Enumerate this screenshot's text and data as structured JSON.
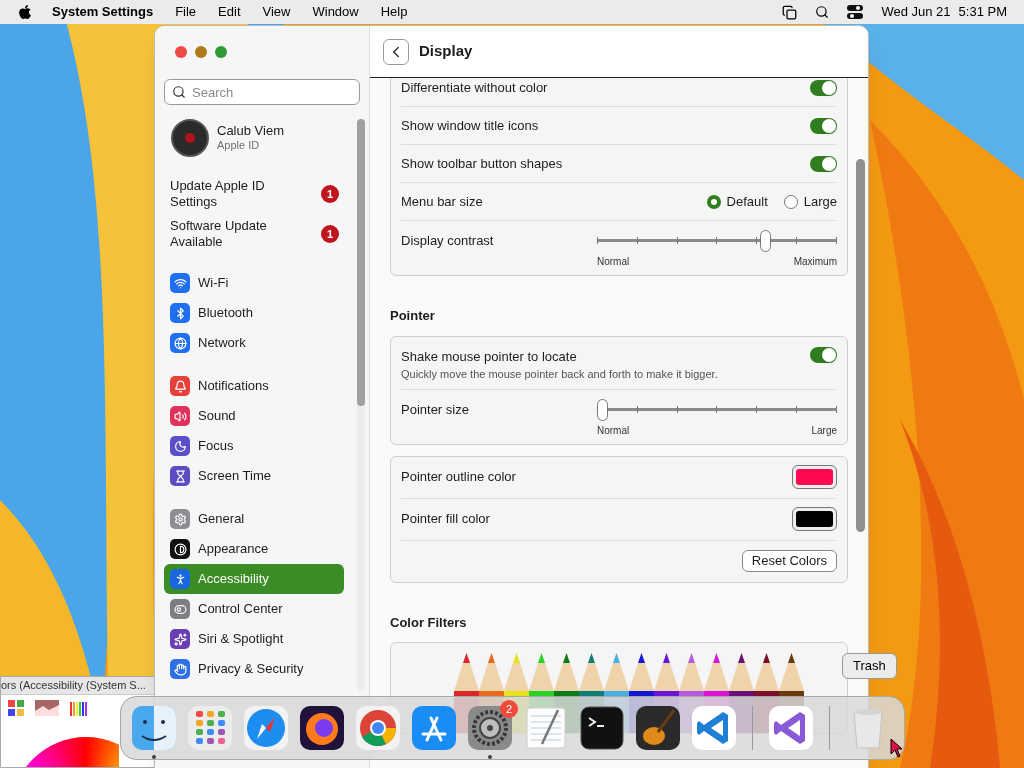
{
  "menu_bar": {
    "app_name": "System Settings",
    "menus": [
      "File",
      "Edit",
      "View",
      "Window",
      "Help"
    ],
    "date": "Wed Jun 21",
    "time": "5:31 PM"
  },
  "sidebar": {
    "search_placeholder": "Search",
    "account": {
      "name": "Calub Viem",
      "subtitle": "Apple ID"
    },
    "notices": [
      {
        "label": "Update Apple ID Settings",
        "badge": "1"
      },
      {
        "label": "Software Update Available",
        "badge": "1"
      }
    ],
    "groups": [
      {
        "items": [
          {
            "kind": "wifi",
            "label": "Wi-Fi",
            "selected": false
          },
          {
            "kind": "bluetooth",
            "label": "Bluetooth",
            "selected": false
          },
          {
            "kind": "network",
            "label": "Network",
            "selected": false
          }
        ]
      },
      {
        "items": [
          {
            "kind": "notifications",
            "label": "Notifications",
            "selected": false
          },
          {
            "kind": "sound",
            "label": "Sound",
            "selected": false
          },
          {
            "kind": "focus",
            "label": "Focus",
            "selected": false
          },
          {
            "kind": "screentime",
            "label": "Screen Time",
            "selected": false
          }
        ]
      },
      {
        "items": [
          {
            "kind": "general",
            "label": "General",
            "selected": false
          },
          {
            "kind": "appearance",
            "label": "Appearance",
            "selected": false
          },
          {
            "kind": "accessibility",
            "label": "Accessibility",
            "selected": true
          },
          {
            "kind": "controlcenter",
            "label": "Control Center",
            "selected": false
          },
          {
            "kind": "siri",
            "label": "Siri & Spotlight",
            "selected": false
          },
          {
            "kind": "privacy",
            "label": "Privacy & Security",
            "selected": false
          }
        ]
      }
    ]
  },
  "display": {
    "title": "Display",
    "sections": [
      {
        "groups": [
          {
            "rows": [
              {
                "kind": "toggle",
                "label": "Differentiate without color",
                "on": true
              },
              {
                "kind": "toggle",
                "label": "Show window title icons",
                "on": true
              },
              {
                "kind": "toggle",
                "label": "Show toolbar button shapes",
                "on": true
              },
              {
                "kind": "radio",
                "label": "Menu bar size",
                "options": [
                  {
                    "label": "Default",
                    "selected": true
                  },
                  {
                    "label": "Large",
                    "selected": false
                  }
                ]
              },
              {
                "kind": "slider",
                "label": "Display contrast",
                "level": 0.71,
                "min_label": "Normal",
                "max_label": "Maximum"
              }
            ]
          }
        ]
      },
      {
        "heading": "Pointer",
        "groups": [
          {
            "rows": [
              {
                "kind": "toggle",
                "label": "Shake mouse pointer to locate",
                "description": "Quickly move the mouse pointer back and forth to make it bigger.",
                "on": true
              },
              {
                "kind": "slider",
                "label": "Pointer size",
                "level": 0,
                "min_label": "Normal",
                "max_label": "Large"
              }
            ]
          },
          {
            "rows": [
              {
                "kind": "color",
                "label": "Pointer outline color",
                "color": "#ff0a50"
              },
              {
                "kind": "color",
                "label": "Pointer fill color",
                "color": "#000000"
              },
              {
                "kind": "button",
                "label": "Reset Colors"
              }
            ]
          }
        ]
      },
      {
        "heading": "Color Filters"
      }
    ]
  },
  "color_window": {
    "title": "ors (Accessibility (System S..."
  },
  "dock": {
    "tooltip": "Trash",
    "items": [
      {
        "kind": "finder",
        "running": true
      },
      {
        "kind": "launchpad",
        "running": false
      },
      {
        "kind": "safari",
        "running": false
      },
      {
        "kind": "firefox",
        "running": false
      },
      {
        "kind": "chrome",
        "running": false
      },
      {
        "kind": "appstore",
        "running": false
      },
      {
        "kind": "settings",
        "running": true,
        "badge": "2"
      },
      {
        "kind": "textedit",
        "running": false
      },
      {
        "kind": "terminal",
        "running": false
      },
      {
        "kind": "garageband",
        "running": false
      },
      {
        "kind": "vscode",
        "running": false
      },
      {
        "kind": "separator"
      },
      {
        "kind": "visualstudio",
        "running": false
      },
      {
        "kind": "separator"
      },
      {
        "kind": "trash",
        "running": false
      }
    ]
  }
}
